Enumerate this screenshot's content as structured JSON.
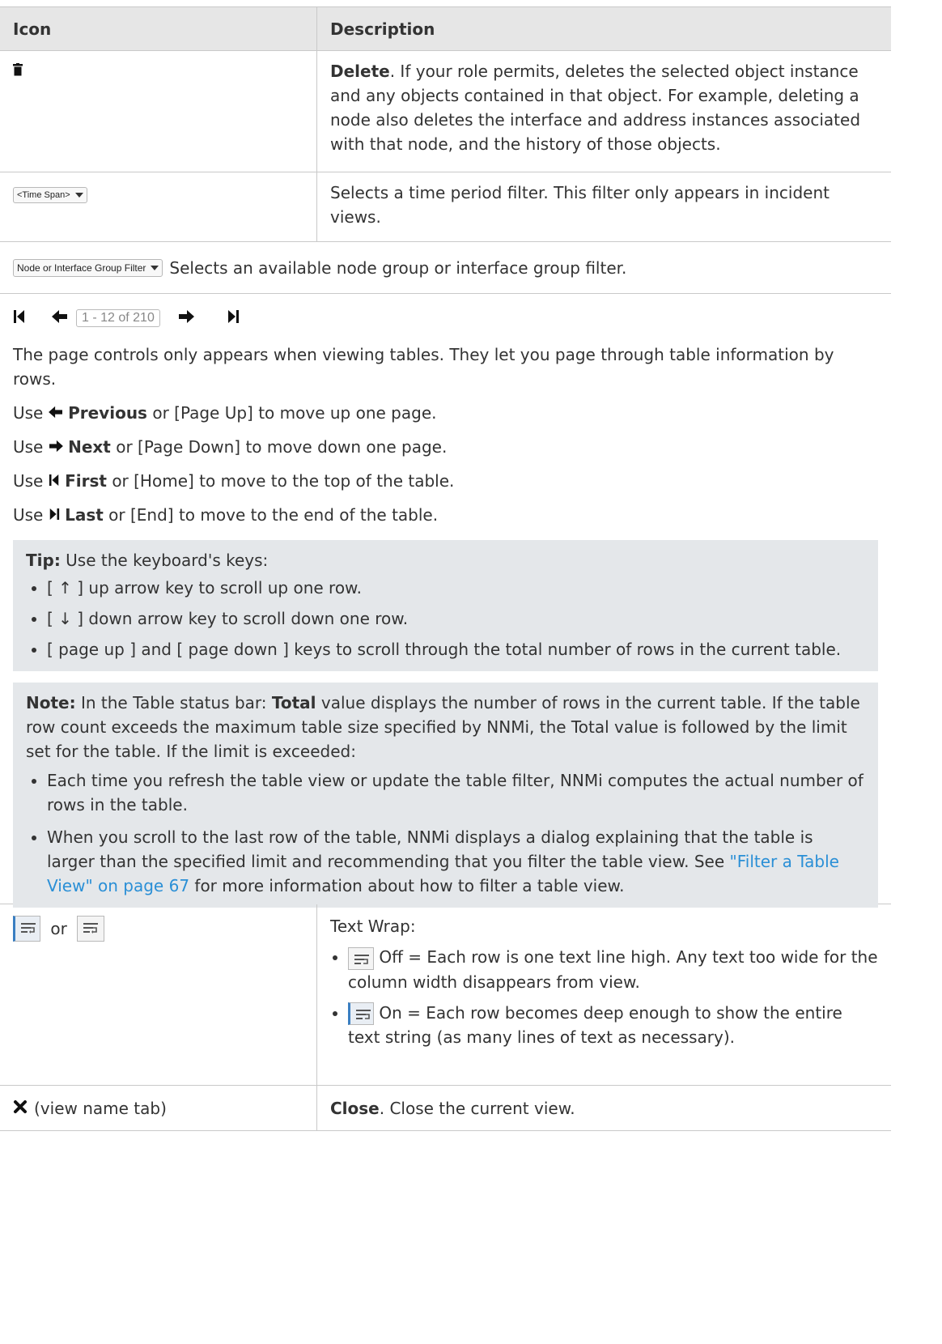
{
  "header": {
    "icon": "Icon",
    "description": "Description"
  },
  "delete_row": {
    "icon": "trash-icon",
    "title": "Delete",
    "text": ". If your role permits, deletes the selected object instance and any objects contained in that object. For example, deleting a node also deletes the interface and address instances associated with that node, and the history of those objects."
  },
  "timespan_row": {
    "dropdown_label": "<Time Span>",
    "text": "Selects a time period filter. This filter only appears in incident views."
  },
  "group_filter_row": {
    "dropdown_label": "Node or Interface Group Filter",
    "text": "Selects an available node group or interface group filter."
  },
  "pager_row": {
    "page_box": "1 - 12 of 210",
    "intro": "The page controls only appears when viewing tables. They let you page through table information by rows.",
    "use": "Use",
    "previous_label": "Previous",
    "previous_rest": "or [Page Up] to move up one page.",
    "next_label": "Next",
    "next_rest": "or [Page Down] to move down one page.",
    "first_label": "First",
    "first_rest": "or [Home] to move to the top of the table.",
    "last_label": "Last",
    "last_rest": "or [End] to move to the end of the table.",
    "tip_label": "Tip:",
    "tip_text": "Use the keyboard's keys:",
    "tip_items": [
      "[ ↑ ] up arrow key to scroll up one row.",
      "[ ↓ ] down arrow key to scroll down one row.",
      "[ page up ] and [ page down ] keys to scroll through the total number of rows in the current table."
    ],
    "note_label": "Note:",
    "note_pre": "In the Table status bar:",
    "note_total": "Total",
    "note_post": "value displays the number of rows in the current table. If the table row count exceeds the maximum table size specified by NNMi, the Total value is followed by the limit set for the table. If the limit is exceeded:",
    "note_item1": "Each time you refresh the table view or update the table filter, NNMi computes the actual number of rows in the table.",
    "note_item2_pre": "When you scroll to the last row of the table, NNMi displays a dialog explaining that the table is larger than the specified limit and recommending that you filter the table view. See",
    "note_item2_link": "\"Filter a Table View\" on page 67",
    "note_item2_post": "for more information about how to filter a table view."
  },
  "textwrap_row": {
    "or": "or",
    "title": "Text Wrap:",
    "off_text": "Off = Each row is one text line high. Any text too wide for the column width disappears from view.",
    "on_text": "On = Each row becomes deep enough to show the entire text string (as many lines of text as necessary)."
  },
  "close_row": {
    "icon_text": "(view name tab)",
    "title": "Close",
    "text": ". Close the current view."
  },
  "colors": {
    "header_bg": "#e6e6e6",
    "callout_bg": "#e4e7ea",
    "link": "#2a8fd6"
  }
}
